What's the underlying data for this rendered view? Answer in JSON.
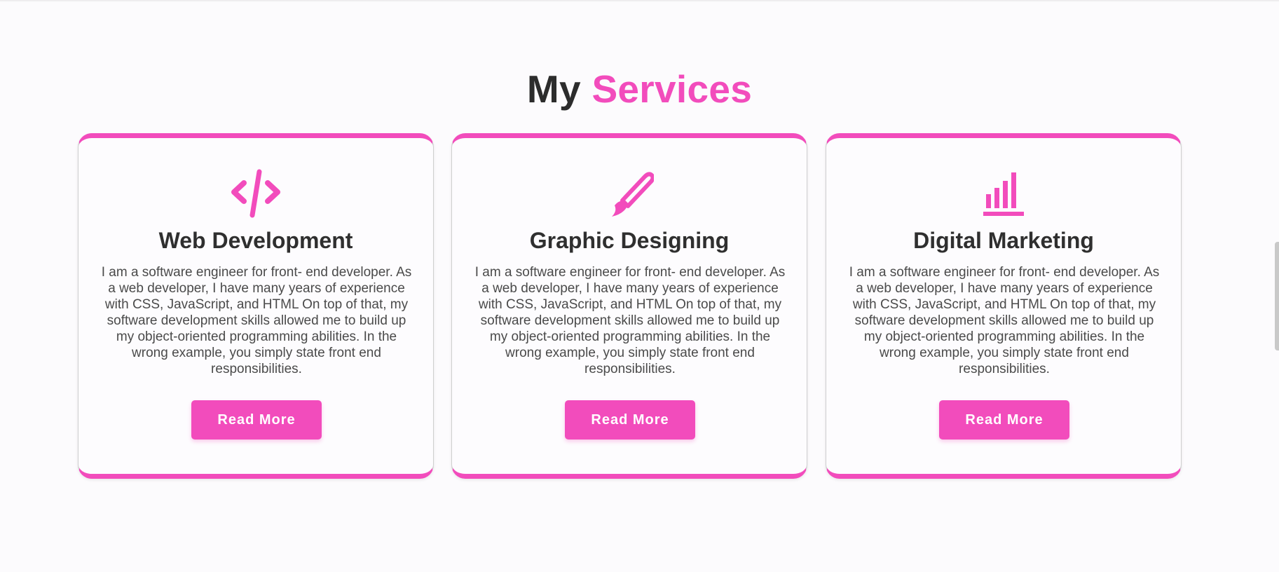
{
  "section": {
    "title_word_1": "My",
    "title_word_2": "Services",
    "accent_color": "#f24cbc",
    "text_color": "#2f2f2f"
  },
  "services": [
    {
      "icon": "code-icon",
      "title": "Web Development",
      "description": "I am a software engineer for front- end developer. As a web developer, I have many years of experience with CSS, JavaScript, and HTML On top of that, my software development skills allowed me to build up my object-oriented programming abilities. In the wrong example, you simply state front end responsibilities.",
      "button_label": "Read More"
    },
    {
      "icon": "paint-brush-icon",
      "title": "Graphic Designing",
      "description": "I am a software engineer for front- end developer. As a web developer, I have many years of experience with CSS, JavaScript, and HTML On top of that, my software development skills allowed me to build up my object-oriented programming abilities. In the wrong example, you simply state front end responsibilities.",
      "button_label": "Read More"
    },
    {
      "icon": "bar-chart-icon",
      "title": "Digital Marketing",
      "description": "I am a software engineer for front- end developer. As a web developer, I have many years of experience with CSS, JavaScript, and HTML On top of that, my software development skills allowed me to build up my object-oriented programming abilities. In the wrong example, you simply state front end responsibilities.",
      "button_label": "Read More"
    }
  ]
}
